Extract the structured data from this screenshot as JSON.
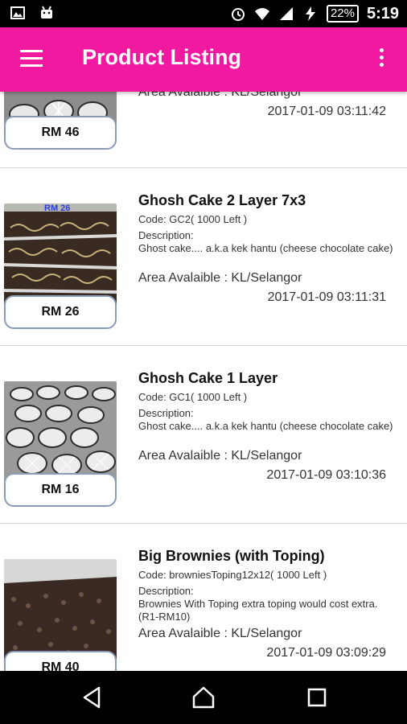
{
  "status_bar": {
    "icons_left": [
      "image-icon",
      "android-icon"
    ],
    "icons_right": [
      "alarm-icon",
      "wifi-icon",
      "signal-icon",
      "charging-icon"
    ],
    "battery": "22%",
    "time": "5:19"
  },
  "app_bar": {
    "title": "Product Listing",
    "menu_icon": "hamburger-icon",
    "overflow_icon": "more-vert-icon",
    "color": "#f0199f"
  },
  "products": [
    {
      "name": "",
      "code": "",
      "description_label": "",
      "description": "",
      "area": "Area Avalaible : KL/Selangor",
      "date": "2017-01-09 03:11:42",
      "price": "RM 46",
      "image_label": ""
    },
    {
      "name": "Ghosh Cake 2 Layer 7x3",
      "code": "Code: GC2( 1000 Left )",
      "description_label": "Description:",
      "description": "Ghost cake.... a.k.a kek hantu (cheese chocolate cake)",
      "area": "Area Avalaible : KL/Selangor",
      "date": "2017-01-09 03:11:31",
      "price": "RM 26",
      "image_label": "RM 26"
    },
    {
      "name": "Ghosh Cake 1 Layer",
      "code": "Code: GC1( 1000 Left )",
      "description_label": "Description:",
      "description": "Ghost cake.... a.k.a kek hantu (cheese chocolate cake)",
      "area": "Area Avalaible : KL/Selangor",
      "date": "2017-01-09 03:10:36",
      "price": "RM 16",
      "image_label": ""
    },
    {
      "name": "Big Brownies (with Toping)",
      "code": "Code: browniesToping12x12( 1000 Left )",
      "description_label": "Description:",
      "description": "Brownies With Toping extra toping would cost extra. (R1-RM10)",
      "area": "Area Avalaible : KL/Selangor",
      "date": "2017-01-09 03:09:29",
      "price": "RM 40",
      "image_label": ""
    }
  ],
  "nav_bar": {
    "back_icon": "back-triangle-icon",
    "home_icon": "home-icon",
    "recents_icon": "recents-square-icon"
  }
}
